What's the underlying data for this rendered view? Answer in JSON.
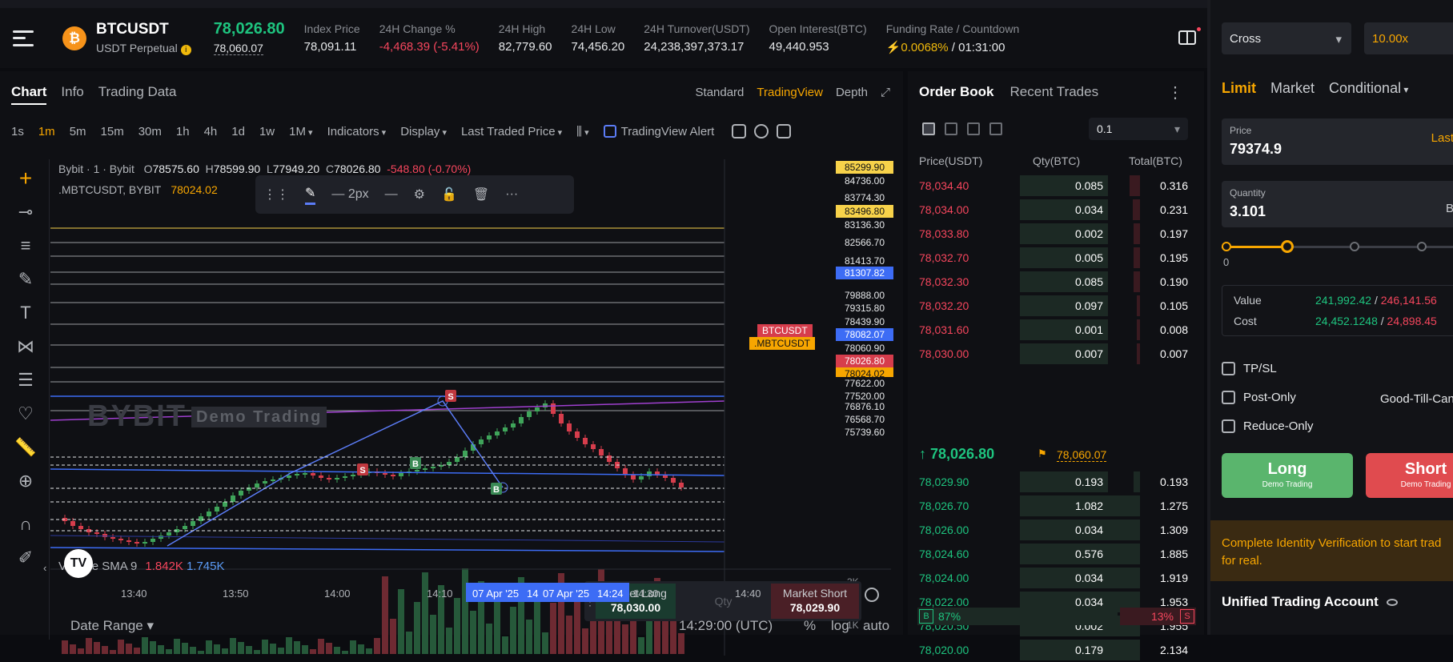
{
  "header": {
    "symbol": "BTCUSDT",
    "contract_type": "USDT Perpetual",
    "coin_icon": "₿",
    "last_price": "78,026.80",
    "mark_price": "78,060.07",
    "stats": [
      {
        "label": "Index Price",
        "value": "78,091.11"
      },
      {
        "label": "24H Change %",
        "value": "-4,468.39 (-5.41%)"
      },
      {
        "label": "24H High",
        "value": "82,779.60"
      },
      {
        "label": "24H Low",
        "value": "74,456.20"
      },
      {
        "label": "24H Turnover(USDT)",
        "value": "24,238,397,373.17"
      },
      {
        "label": "Open Interest(BTC)",
        "value": "49,440.953"
      }
    ],
    "funding_label": "Funding Rate / Countdown",
    "funding_rate": "0.0068%",
    "countdown": "/ 01:31:00"
  },
  "chart": {
    "tabs": [
      "Chart",
      "Info",
      "Trading Data"
    ],
    "views": [
      "Standard",
      "TradingView",
      "Depth"
    ],
    "timeframes": [
      "1s",
      "1m",
      "5m",
      "15m",
      "30m",
      "1h",
      "4h",
      "1d",
      "1w",
      "1M"
    ],
    "indicators_label": "Indicators",
    "display_label": "Display",
    "price_type_label": "Last Traded Price",
    "tv_alert_label": "TradingView Alert",
    "ohlc": {
      "source": "Bybit · 1 · Bybit",
      "o": "78575.60",
      "h": "78599.90",
      "l": "77949.20",
      "c": "78026.80",
      "change": "-548.80 (-0.70%)"
    },
    "index_overlay": {
      "name": ".MBTCUSDT, BYBIT",
      "value": "78024.02"
    },
    "draw_toolbar": {
      "width_label": "2px"
    },
    "watermark": "BYBIT",
    "watermark_demo": "Demo Trading",
    "volume": {
      "label": "Volume SMA 9",
      "v1": "1.842K",
      "v2": "1.745K"
    },
    "price_tags": [
      {
        "text": "85299.90",
        "kind": "y"
      },
      {
        "text": "84736.00",
        "kind": "n"
      },
      {
        "text": "83774.30",
        "kind": "n"
      },
      {
        "text": "83496.80",
        "kind": "y"
      },
      {
        "text": "83136.30",
        "kind": "n"
      },
      {
        "text": "82566.70",
        "kind": "n"
      },
      {
        "text": "81413.70",
        "kind": "n"
      },
      {
        "text": "81307.82",
        "kind": "b"
      },
      {
        "text": "79888.00",
        "kind": "n"
      },
      {
        "text": "79315.80",
        "kind": "n"
      },
      {
        "text": "78439.90",
        "kind": "n"
      },
      {
        "text": "78082.07",
        "kind": "b"
      },
      {
        "text": "78060.90",
        "kind": "n"
      },
      {
        "text": "78026.80",
        "kind": "r"
      },
      {
        "text": "78024.02",
        "kind": "o"
      },
      {
        "text": "77622.00",
        "kind": "n"
      },
      {
        "text": "77520.00",
        "kind": "n"
      },
      {
        "text": "76876.10",
        "kind": "n"
      },
      {
        "text": "76568.70",
        "kind": "n"
      },
      {
        "text": "75739.60",
        "kind": "n"
      }
    ],
    "side_tags": {
      "symbol": "BTCUSDT",
      "index": ".MBTCUSDT"
    },
    "volume_axis": [
      "3K",
      "1K"
    ],
    "market_box": {
      "long_label": "Market Long",
      "long_price": "78,030.00",
      "qty_placeholder": "Qty",
      "short_label": "Market Short",
      "short_price": "78,029.90"
    },
    "time_labels": [
      "13:40",
      "13:50",
      "14:00",
      "14:10",
      "14:30",
      "14:40"
    ],
    "time_highlight": [
      "07 Apr '25",
      "14",
      "07 Apr '25",
      "14:24"
    ],
    "bottom": {
      "date_range": "Date Range",
      "utc": "14:29:00 (UTC)",
      "pct": "%",
      "log": "log",
      "auto": "auto"
    },
    "markers": [
      "S",
      "S",
      "B",
      "B"
    ]
  },
  "orderbook": {
    "tabs": [
      "Order Book",
      "Recent Trades"
    ],
    "tick": "0.1",
    "headers": [
      "Price(USDT)",
      "Qty(BTC)",
      "Total(BTC)"
    ],
    "asks": [
      {
        "p": "78,034.40",
        "q": "0.085",
        "t": "0.316"
      },
      {
        "p": "78,034.00",
        "q": "0.034",
        "t": "0.231"
      },
      {
        "p": "78,033.80",
        "q": "0.002",
        "t": "0.197"
      },
      {
        "p": "78,032.70",
        "q": "0.005",
        "t": "0.195"
      },
      {
        "p": "78,032.30",
        "q": "0.085",
        "t": "0.190"
      },
      {
        "p": "78,032.20",
        "q": "0.097",
        "t": "0.105"
      },
      {
        "p": "78,031.60",
        "q": "0.001",
        "t": "0.008"
      },
      {
        "p": "78,030.00",
        "q": "0.007",
        "t": "0.007"
      }
    ],
    "mid_price": "78,026.80",
    "mid_mark": "78,060.07",
    "bids": [
      {
        "p": "78,029.90",
        "q": "0.193",
        "t": "0.193"
      },
      {
        "p": "78,026.70",
        "q": "1.082",
        "t": "1.275"
      },
      {
        "p": "78,026.00",
        "q": "0.034",
        "t": "1.309"
      },
      {
        "p": "78,024.60",
        "q": "0.576",
        "t": "1.885"
      },
      {
        "p": "78,024.00",
        "q": "0.034",
        "t": "1.919"
      },
      {
        "p": "78,022.00",
        "q": "0.034",
        "t": "1.953"
      },
      {
        "p": "78,020.50",
        "q": "0.002",
        "t": "1.955"
      },
      {
        "p": "78,020.00",
        "q": "0.179",
        "t": "2.134"
      }
    ],
    "buy_pct": "87%",
    "sell_pct": "13%"
  },
  "trade": {
    "margin_mode": "Cross",
    "leverage": "10.00x",
    "order_tabs": [
      "Limit",
      "Market",
      "Conditional"
    ],
    "price_label": "Price",
    "price_value": "79374.9",
    "price_right": "Last",
    "qty_label": "Quantity",
    "qty_value": "3.101",
    "qty_right": "B",
    "slider_min": "0",
    "value_label": "Value",
    "value_buy": "241,992.42",
    "value_sell": "246,141.56",
    "cost_label": "Cost",
    "cost_buy": "24,452.1248",
    "cost_sell": "24,898.45",
    "tpsl": "TP/SL",
    "post_only": "Post-Only",
    "reduce_only": "Reduce-Only",
    "tif": "Good-Till-Canc",
    "long_label": "Long",
    "short_label": "Short",
    "demo_sub": "Demo Trading",
    "kyc_line1": "Complete Identity Verification to start trad",
    "kyc_line2": "for real.",
    "account": "Unified Trading Account"
  }
}
